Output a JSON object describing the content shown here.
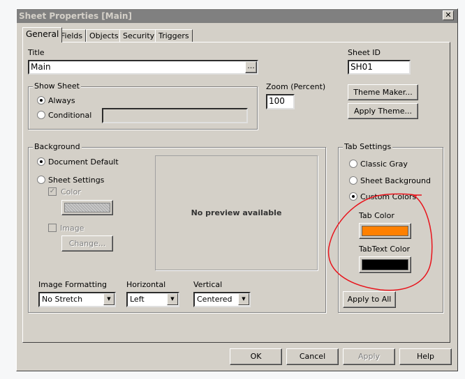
{
  "window": {
    "title": "Sheet Properties [Main]",
    "close_icon": "close-icon"
  },
  "tabs": [
    "General",
    "Fields",
    "Objects",
    "Security",
    "Triggers"
  ],
  "general": {
    "title_label": "Title",
    "title_value": "Main",
    "title_button": "...",
    "sheet_id_label": "Sheet ID",
    "sheet_id_value": "SH01",
    "show_sheet": {
      "legend": "Show Sheet",
      "always": "Always",
      "conditional": "Conditional",
      "selected": "Always"
    },
    "zoom_label": "Zoom (Percent)",
    "zoom_value": "100",
    "theme_maker": "Theme Maker...",
    "apply_theme": "Apply Theme...",
    "background": {
      "legend": "Background",
      "document_default": "Document Default",
      "sheet_settings": "Sheet Settings",
      "selected": "Document Default",
      "color_label": "Color",
      "color_checked": true,
      "image_label": "Image",
      "image_checked": false,
      "change_button": "Change...",
      "preview_text": "No preview available",
      "image_formatting_label": "Image Formatting",
      "image_formatting_value": "No Stretch",
      "horizontal_label": "Horizontal",
      "horizontal_value": "Left",
      "vertical_label": "Vertical",
      "vertical_value": "Centered"
    },
    "tab_settings": {
      "legend": "Tab Settings",
      "classic_gray": "Classic Gray",
      "sheet_background": "Sheet Background",
      "custom_colors": "Custom Colors",
      "selected": "Custom Colors",
      "tab_color_label": "Tab Color",
      "tab_color": "#ff8000",
      "tabtext_color_label": "TabText Color",
      "tabtext_color": "#000000",
      "apply_to_all": "Apply to All"
    }
  },
  "buttons": {
    "ok": "OK",
    "cancel": "Cancel",
    "apply": "Apply",
    "help": "Help"
  },
  "annotation_color": "#e8141c"
}
